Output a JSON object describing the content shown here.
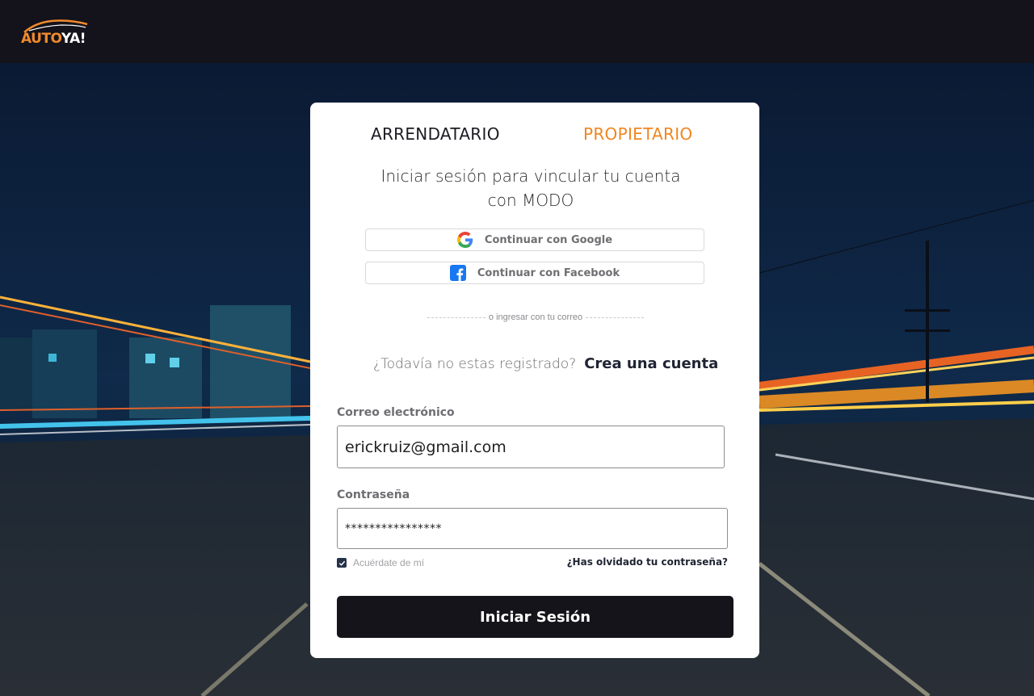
{
  "brand": {
    "logo_part1": "AUTO",
    "logo_part2": "YA!"
  },
  "tabs": {
    "renter": "ARRENDATARIO",
    "owner": "PROPIETARIO"
  },
  "login": {
    "heading_line1": "Iniciar sesión para vincular tu cuenta",
    "heading_line2": "con MODO",
    "google_label": "Continuar con Google",
    "facebook_label": "Continuar con Facebook",
    "divider_text": "o ingresar con tu correo",
    "register_question": "¿Todavía no estas registrado?",
    "register_link": "Crea una cuenta",
    "email_label": "Correo electrónico",
    "email_value": "erickruiz@gmail.com",
    "password_label": "Contraseña",
    "password_value": "****************",
    "remember_label": "Acuérdate de mí",
    "remember_checked": true,
    "forgot_label": "¿Has olvidado tu contraseña?",
    "submit_label": "Iniciar Sesión"
  },
  "colors": {
    "accent": "#f0861f",
    "topbar": "#14121a",
    "button": "#15141a",
    "link": "#1e2432"
  },
  "icons": [
    "car-logo-icon",
    "google-icon",
    "facebook-icon",
    "check-icon"
  ]
}
